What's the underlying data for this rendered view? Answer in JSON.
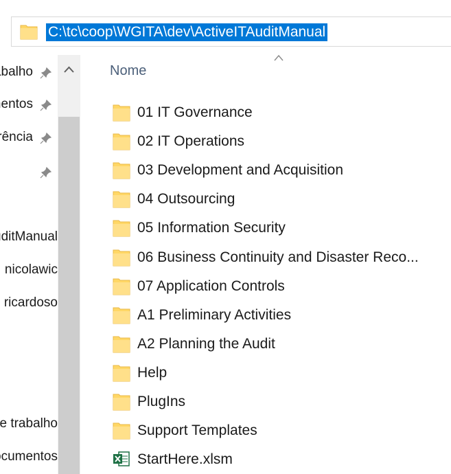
{
  "address": {
    "path": "C:\\tc\\coop\\WGITA\\dev\\ActiveITAuditManual",
    "icon": "folder-icon"
  },
  "nav": {
    "items": [
      {
        "label": "Área de trabalho",
        "pinned": true
      },
      {
        "label": "Documentos",
        "pinned": true
      },
      {
        "label": "Transferência",
        "pinned": true
      },
      {
        "label": "",
        "pinned": true
      },
      {
        "label": "ActiveITAuditManual",
        "pinned": false
      },
      {
        "label": "nicolawic",
        "pinned": false
      },
      {
        "label": "ricardoso",
        "pinned": false
      },
      {
        "label": "Área de trabalho",
        "pinned": false
      },
      {
        "label": "Documentos",
        "pinned": false
      }
    ],
    "scroll_up_glyph": "^"
  },
  "content": {
    "column_header": "Nome",
    "files": [
      {
        "name": "01 IT Governance",
        "icon": "folder-icon"
      },
      {
        "name": "02 IT Operations",
        "icon": "folder-icon"
      },
      {
        "name": "03 Development and Acquisition",
        "icon": "folder-icon"
      },
      {
        "name": "04 Outsourcing",
        "icon": "folder-icon"
      },
      {
        "name": "05 Information Security",
        "icon": "folder-icon"
      },
      {
        "name": "06 Business Continuity and Disaster Reco...",
        "icon": "folder-icon"
      },
      {
        "name": "07 Application Controls",
        "icon": "folder-icon"
      },
      {
        "name": "A1 Preliminary Activities",
        "icon": "folder-icon"
      },
      {
        "name": "A2 Planning the Audit",
        "icon": "folder-icon"
      },
      {
        "name": "Help",
        "icon": "folder-icon"
      },
      {
        "name": "PlugIns",
        "icon": "folder-icon"
      },
      {
        "name": "Support Templates",
        "icon": "folder-icon"
      },
      {
        "name": "StartHere.xlsm",
        "icon": "excel-file-icon"
      }
    ]
  },
  "colors": {
    "selection": "#0078d7",
    "folder": "#ffd766",
    "folder_edge": "#e8b84a",
    "header_text": "#4c607a",
    "excel_green": "#1e7145"
  }
}
